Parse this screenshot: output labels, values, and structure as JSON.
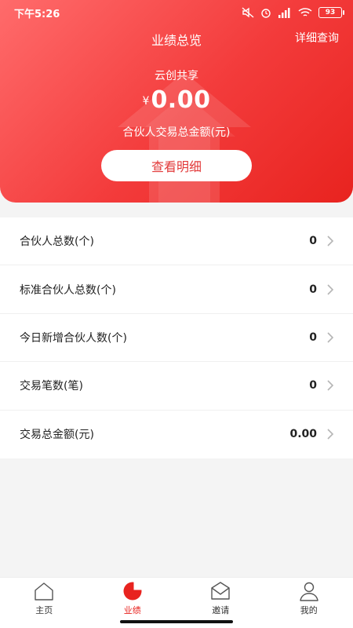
{
  "status": {
    "time": "下午5:26",
    "battery": "93"
  },
  "header": {
    "title": "业绩总览",
    "detail_query": "详细查询",
    "company": "云创共享",
    "currency": "¥",
    "amount": "0.00",
    "amount_label": "合伙人交易总金额(元)",
    "detail_button": "查看明细"
  },
  "stats": [
    {
      "label": "合伙人总数(个)",
      "value": "0"
    },
    {
      "label": "标准合伙人总数(个)",
      "value": "0"
    },
    {
      "label": "今日新增合伙人数(个)",
      "value": "0"
    },
    {
      "label": "交易笔数(笔)",
      "value": "0"
    },
    {
      "label": "交易总金额(元)",
      "value": "0.00"
    }
  ],
  "tabs": [
    {
      "label": "主页",
      "icon": "home-icon"
    },
    {
      "label": "业绩",
      "icon": "pie-chart-icon",
      "active": true
    },
    {
      "label": "邀请",
      "icon": "envelope-icon"
    },
    {
      "label": "我的",
      "icon": "user-icon"
    }
  ],
  "colors": {
    "accent": "#e8231f",
    "hero_start": "#ff6b6b",
    "hero_end": "#e8231f"
  }
}
